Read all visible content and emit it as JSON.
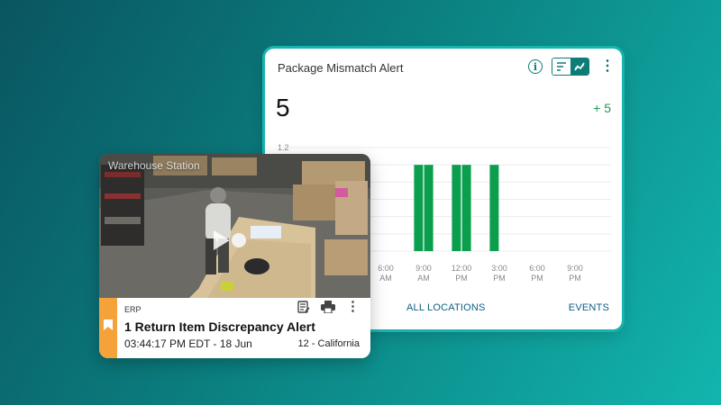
{
  "alert_widget": {
    "title": "Package Mismatch Alert",
    "count": "5",
    "delta": "+ 5",
    "footer_locations": "ALL LOCATIONS",
    "footer_events": "EVENTS",
    "icons": [
      "info-icon",
      "sort-list-icon",
      "line-chart-icon",
      "more-vertical-icon"
    ],
    "accent_color": "#0e7c78",
    "bar_color": "#0b9e4c"
  },
  "chart_data": {
    "type": "bar",
    "y_tick_labels": [
      "1.2"
    ],
    "ylim": [
      0,
      1.2
    ],
    "x_tick_labels": [
      {
        "time": "6:00",
        "ampm": "AM"
      },
      {
        "time": "9:00",
        "ampm": "AM"
      },
      {
        "time": "12:00",
        "ampm": "PM"
      },
      {
        "time": "3:00",
        "ampm": "PM"
      },
      {
        "time": "6:00",
        "ampm": "PM"
      },
      {
        "time": "9:00",
        "ampm": "PM"
      }
    ],
    "grid": true,
    "bars_value": 1,
    "bars_x_hours": [
      8.6,
      9.4,
      11.6,
      12.4,
      14.6
    ]
  },
  "event_card": {
    "camera_label": "Warehouse Station",
    "source": "ERP",
    "title": "1 Return Item Discrepancy Alert",
    "timestamp": "03:44:17 PM EDT - 18 Jun",
    "location": "12 - California",
    "icons": [
      "play-icon",
      "bookmark-icon",
      "notes-icon",
      "print-icon",
      "more-vertical-icon"
    ],
    "ribbon_color": "#f6a23a"
  }
}
